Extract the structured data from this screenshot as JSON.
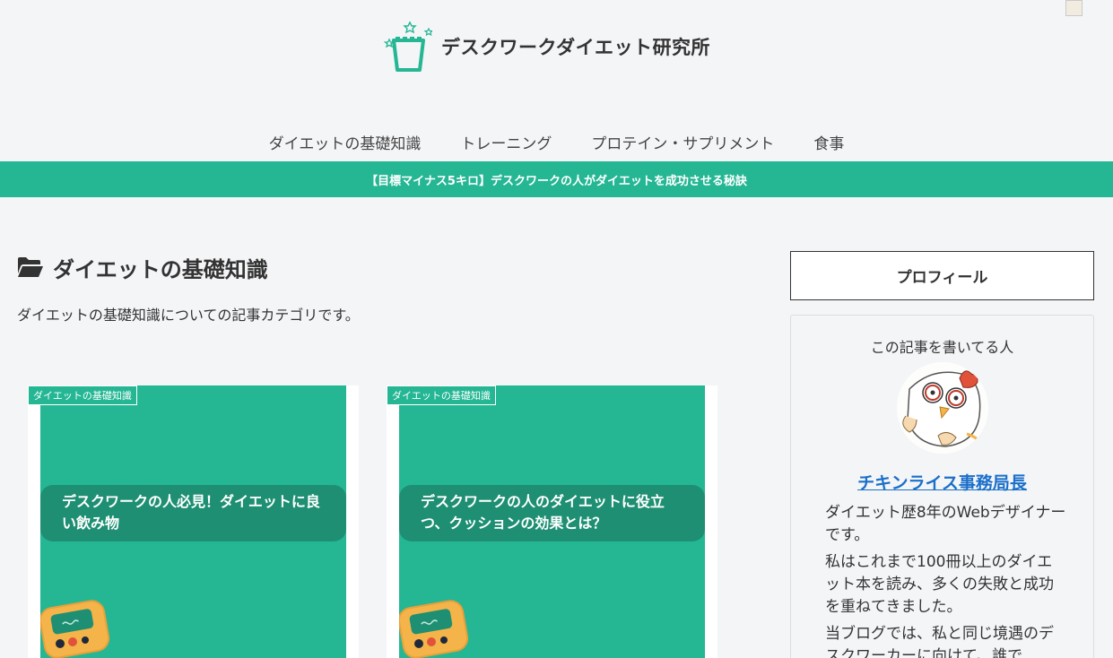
{
  "site": {
    "title": "デスクワークダイエット研究所"
  },
  "nav": {
    "items": [
      {
        "label": "ダイエットの基礎知識"
      },
      {
        "label": "トレーニング"
      },
      {
        "label": "プロテイン・サプリメント"
      },
      {
        "label": "食事"
      }
    ]
  },
  "notice": {
    "text": "【目標マイナス5キロ】デスクワークの人がダイエットを成功させる秘訣"
  },
  "category": {
    "title": "ダイエットの基礎知識",
    "description": "ダイエットの基礎知識についての記事カテゴリです。",
    "icon": "folder-open-icon"
  },
  "cards": [
    {
      "category_label": "ダイエットの基礎知識",
      "thumb_title": "デスクワークの人必見！ダイエットに良い飲み物"
    },
    {
      "category_label": "ダイエットの基礎知識",
      "thumb_title": "デスクワークの人のダイエットに役立つ、クッションの効果とは？"
    }
  ],
  "sidebar": {
    "heading": "プロフィール",
    "caption": "この記事を書いてる人",
    "author_name": "チキンライス事務局長",
    "bio": [
      "ダイエット歴8年のWebデザイナーです。",
      "私はこれまで100冊以上のダイエット本を読み、多くの失敗と成功を重ねてきました。",
      "当ブログでは、私と同じ境遇のデスクワーカーに向けて、誰で"
    ]
  },
  "colors": {
    "accent": "#25b694",
    "accent_dark": "#1e8f73",
    "link": "#1a6fc9",
    "background": "#f4f5f7"
  }
}
